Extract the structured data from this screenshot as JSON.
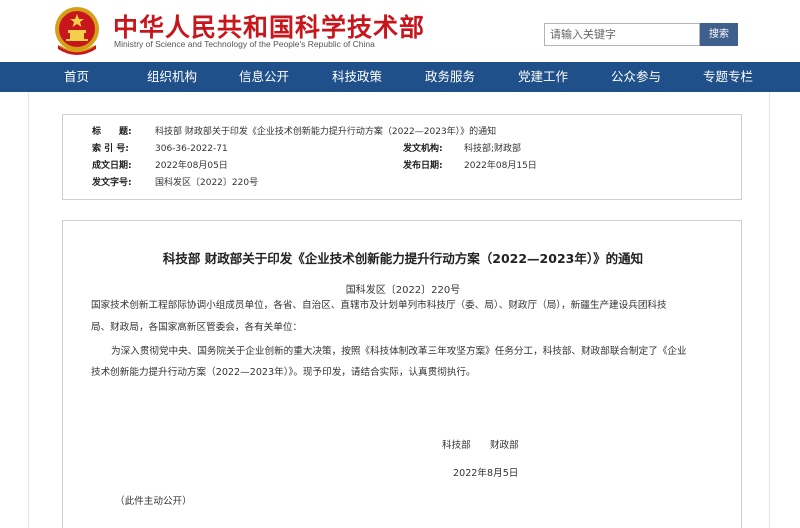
{
  "header": {
    "title": "中华人民共和国科学技术部",
    "subtitle": "Ministry of Science and Technology of the People's Republic of China",
    "search_placeholder": "请输入关键字",
    "search_button": "搜索"
  },
  "nav": {
    "items": [
      "首页",
      "组织机构",
      "信息公开",
      "科技政策",
      "政务服务",
      "党建工作",
      "公众参与",
      "专题专栏"
    ]
  },
  "meta": {
    "title_label": "标　　题:",
    "title_value": "科技部 财政部关于印发《企业技术创新能力提升行动方案（2022—2023年）》的通知",
    "index_label": "索 引 号:",
    "index_value": "306-36-2022-71",
    "issuer_label": "发文机构:",
    "issuer_value": "科技部;财政部",
    "created_label": "成文日期:",
    "created_value": "2022年08月05日",
    "published_label": "发布日期:",
    "published_value": "2022年08月15日",
    "docno_label": "发文字号:",
    "docno_value": "国科发区〔2022〕220号"
  },
  "article": {
    "title": "科技部 财政部关于印发《企业技术创新能力提升行动方案（2022—2023年）》的通知",
    "doc_number": "国科发区〔2022〕220号",
    "addressee_line1": "国家技术创新工程部际协调小组成员单位，各省、自治区、直辖市及计划单列市科技厅（委、局）、财政厅（局），新疆生产建设兵团科技",
    "addressee_line2": "局、财政局，各国家高新区管委会，各有关单位：",
    "body_line1": "为深入贯彻党中央、国务院关于企业创新的重大决策，按照《科技体制改革三年攻坚方案》任务分工，科技部、财政部联合制定了《企业",
    "body_line2": "技术创新能力提升行动方案（2022—2023年）》。现予印发，请结合实际，认真贯彻执行。",
    "signature": "科技部　　财政部",
    "date": "2022年8月5日",
    "note": "（此件主动公开）"
  }
}
